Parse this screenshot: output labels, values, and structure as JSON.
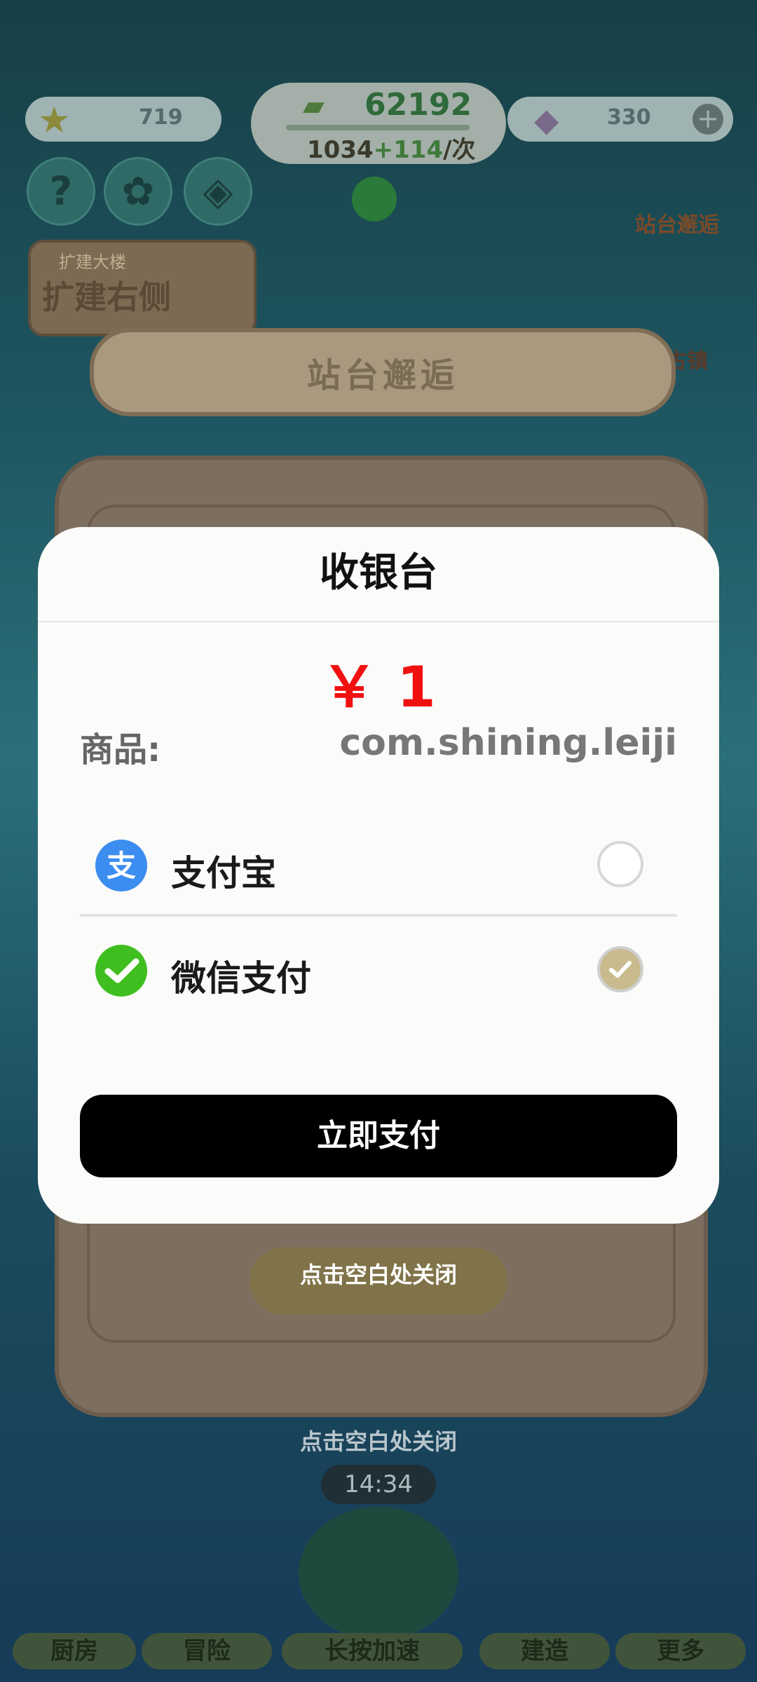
{
  "hud": {
    "stars": "719",
    "cash": "62192",
    "income_base": "1034",
    "income_bonus": "+114",
    "income_unit": "/次",
    "gems": "330"
  },
  "background": {
    "banner_title": "站台邂逅",
    "expand_button": "扩建右侧",
    "expand_tag": "扩建大楼",
    "station_label": "站台邂逅",
    "town_label": "古镇",
    "close_hint": "点击空白处关闭",
    "timer": "14:34",
    "tabs": [
      "厨房",
      "冒险",
      "长按加速",
      "建造",
      "更多"
    ]
  },
  "cashier": {
    "title": "收银台",
    "price": "￥ 1",
    "product_label": "商品:",
    "product_value": "com.shining.leiji",
    "methods": [
      {
        "label": "支付宝",
        "icon": "alipay-icon",
        "color": "#3b8df0",
        "selected": false
      },
      {
        "label": "微信支付",
        "icon": "wechat-pay-icon",
        "color": "#3fbf1f",
        "selected": true
      }
    ],
    "pay_button": "立即支付"
  },
  "colors": {
    "price": "#f01010",
    "selected_radio": "#c9bb8e",
    "pay_button_bg": "#000000"
  }
}
